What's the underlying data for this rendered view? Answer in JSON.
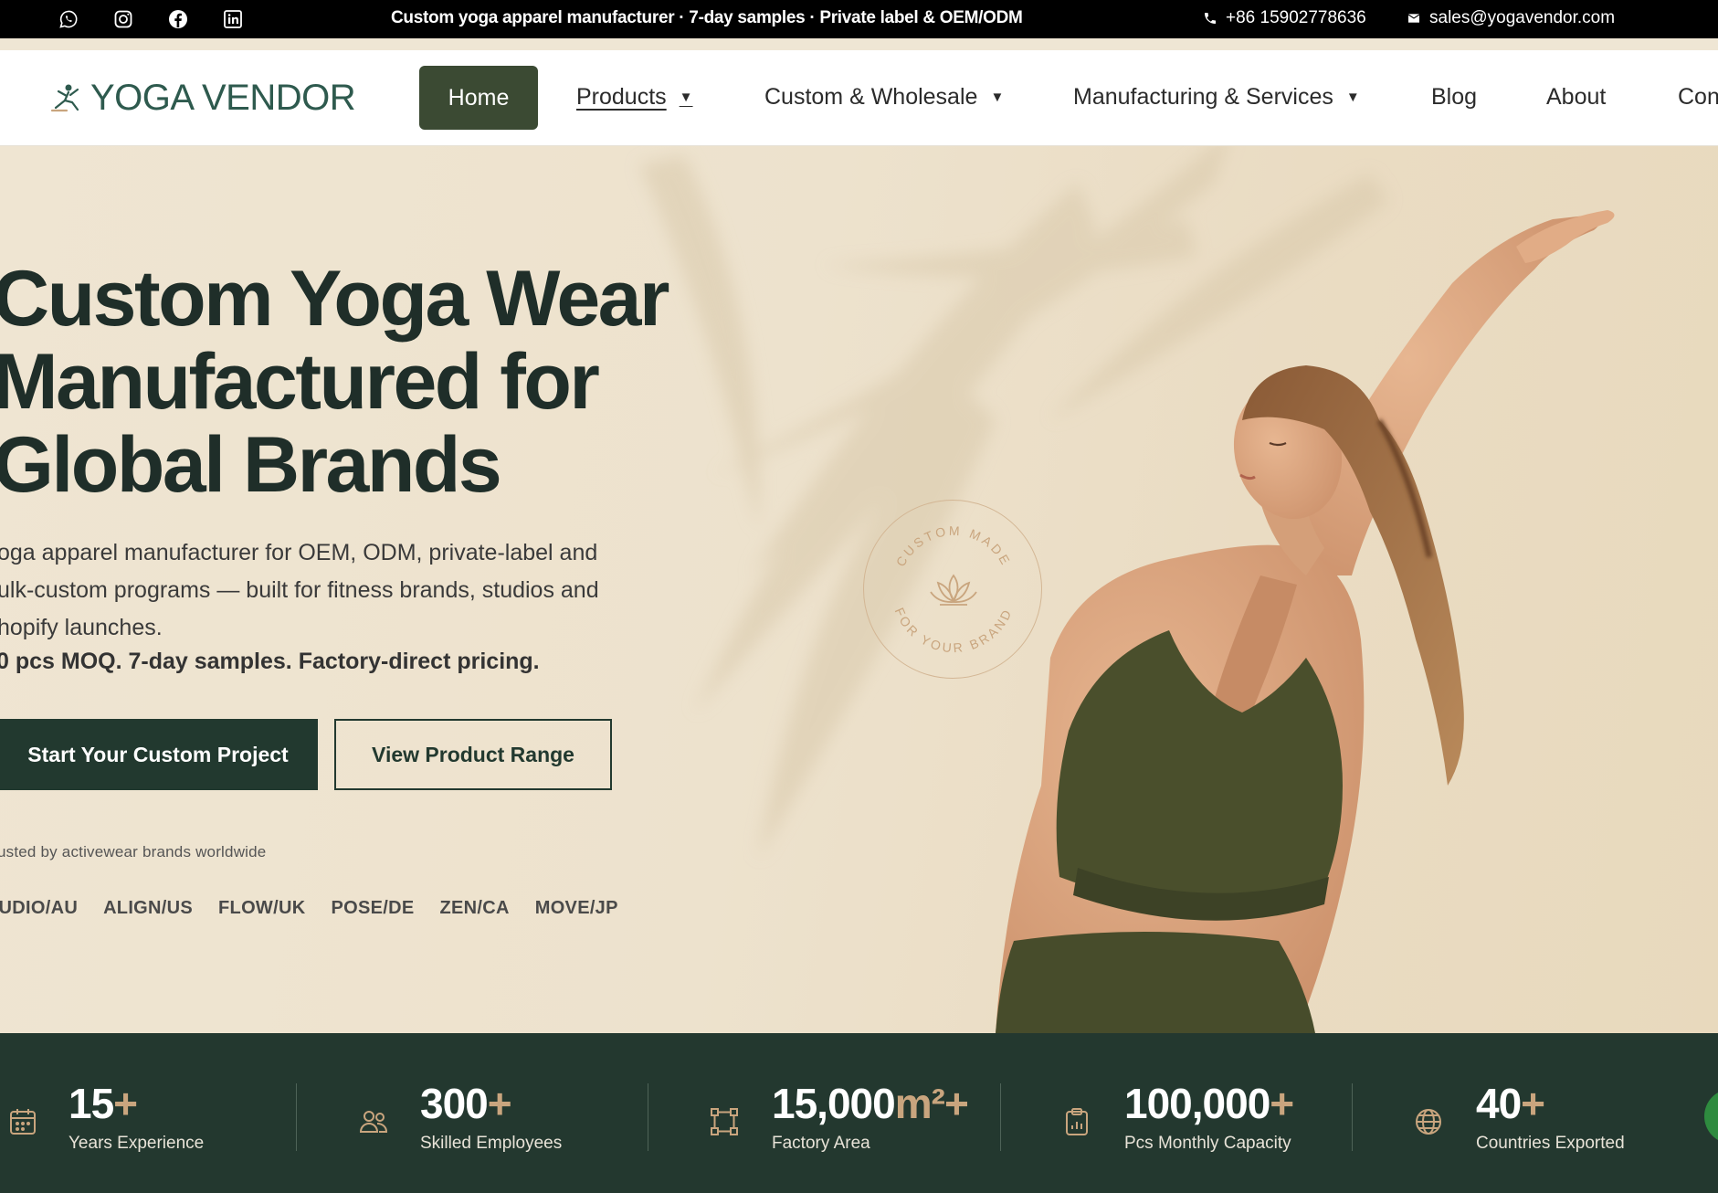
{
  "topbar": {
    "social_icons": [
      "whatsapp-icon",
      "instagram-icon",
      "facebook-icon",
      "linkedin-icon"
    ],
    "announcement": "Custom yoga apparel manufacturer · 7-day samples · Private label & OEM/ODM",
    "phone": "+86 15902778636",
    "email": "sales@yogavendor.com"
  },
  "nav": {
    "logo_text": "YOGA VENDOR",
    "home": "Home",
    "products": "Products",
    "custom_wholesale": "Custom & Wholesale",
    "manufacturing": "Manufacturing & Services",
    "blog": "Blog",
    "about": "About",
    "contact_partial": "Con",
    "caret": "▼"
  },
  "hero": {
    "title_line1": "Custom Yoga Wear",
    "title_line2": "Manufactured for",
    "title_line3": "Global Brands",
    "desc_line1": "oga apparel manufacturer for OEM, ODM, private-label and",
    "desc_line2": "ulk-custom programs — built for fitness brands, studios and",
    "desc_line3": "hopify launches.",
    "bold_line": "0 pcs MOQ. 7-day samples. Factory-direct pricing.",
    "primary_button": "Start Your Custom Project",
    "secondary_button": "View Product Range",
    "trusted_text": "usted by activewear brands worldwide",
    "brands": [
      "TUDIO/AU",
      "ALIGN/US",
      "FLOW/UK",
      "POSE/DE",
      "ZEN/CA",
      "MOVE/JP"
    ],
    "badge_top": "CUSTOM MADE",
    "badge_bottom": "FOR YOUR BRAND"
  },
  "stats": [
    {
      "icon": "calendar-icon",
      "value": "15",
      "unit": "",
      "suffix": "+",
      "label": "Years Experience"
    },
    {
      "icon": "people-icon",
      "value": "300",
      "unit": "",
      "suffix": "+",
      "label": "Skilled Employees"
    },
    {
      "icon": "area-icon",
      "value": "15,000",
      "unit": "m²",
      "suffix": "+",
      "label": "Factory Area"
    },
    {
      "icon": "clipboard-chart-icon",
      "value": "100,000",
      "unit": "",
      "suffix": "+",
      "label": "Pcs Monthly Capacity"
    },
    {
      "icon": "globe-icon",
      "value": "40",
      "unit": "",
      "suffix": "+",
      "label": "Countries Exported"
    }
  ],
  "colors": {
    "dark_green": "#22392f",
    "nav_home_bg": "#3b4a33",
    "accent_gold": "#c9a57e",
    "hero_bg": "#efe5d2"
  }
}
